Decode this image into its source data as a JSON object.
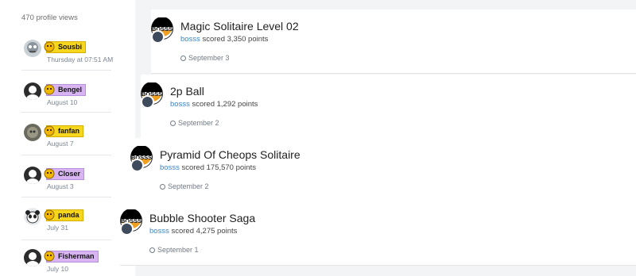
{
  "profile_views": "470 profile views",
  "visitors": [
    {
      "name": "Sousbi",
      "date": "Thursday at 07:51 AM",
      "badge_color": "#f7d61e",
      "avatar": "robot"
    },
    {
      "name": "Bengel",
      "date": "August 10",
      "badge_color": "#d8b5f2",
      "avatar": "default"
    },
    {
      "name": "fanfan",
      "date": "August 7",
      "badge_color": "#f7d61e",
      "avatar": "photo"
    },
    {
      "name": "Closer",
      "date": "August 3",
      "badge_color": "#d8b5f2",
      "avatar": "default"
    },
    {
      "name": "panda",
      "date": "July 31",
      "badge_color": "#f7d61e",
      "avatar": "panda"
    },
    {
      "name": "Fisherman",
      "date": "July 10",
      "badge_color": "#d8b5f2",
      "avatar": "default"
    }
  ],
  "activity": [
    {
      "game": "Magic Solitaire Level 02",
      "user": "bosss",
      "scored_text": "scored",
      "points": "3,350 points",
      "date": "September 3"
    },
    {
      "game": "2p Ball",
      "user": "bosss",
      "scored_text": "scored",
      "points": "1,292 points",
      "date": "September 2"
    },
    {
      "game": "Pyramid Of Cheops Solitaire",
      "user": "bosss",
      "scored_text": "scored",
      "points": "175,570 points",
      "date": "September 2"
    },
    {
      "game": "Bubble Shooter Saga",
      "user": "bosss",
      "scored_text": "scored",
      "points": "4,275 points",
      "date": "September 1"
    }
  ],
  "avatar_label": "BOSSS",
  "colors": {
    "link": "#3a86c8",
    "badge_gold": "#f7d61e",
    "badge_purple": "#d8b5f2"
  }
}
